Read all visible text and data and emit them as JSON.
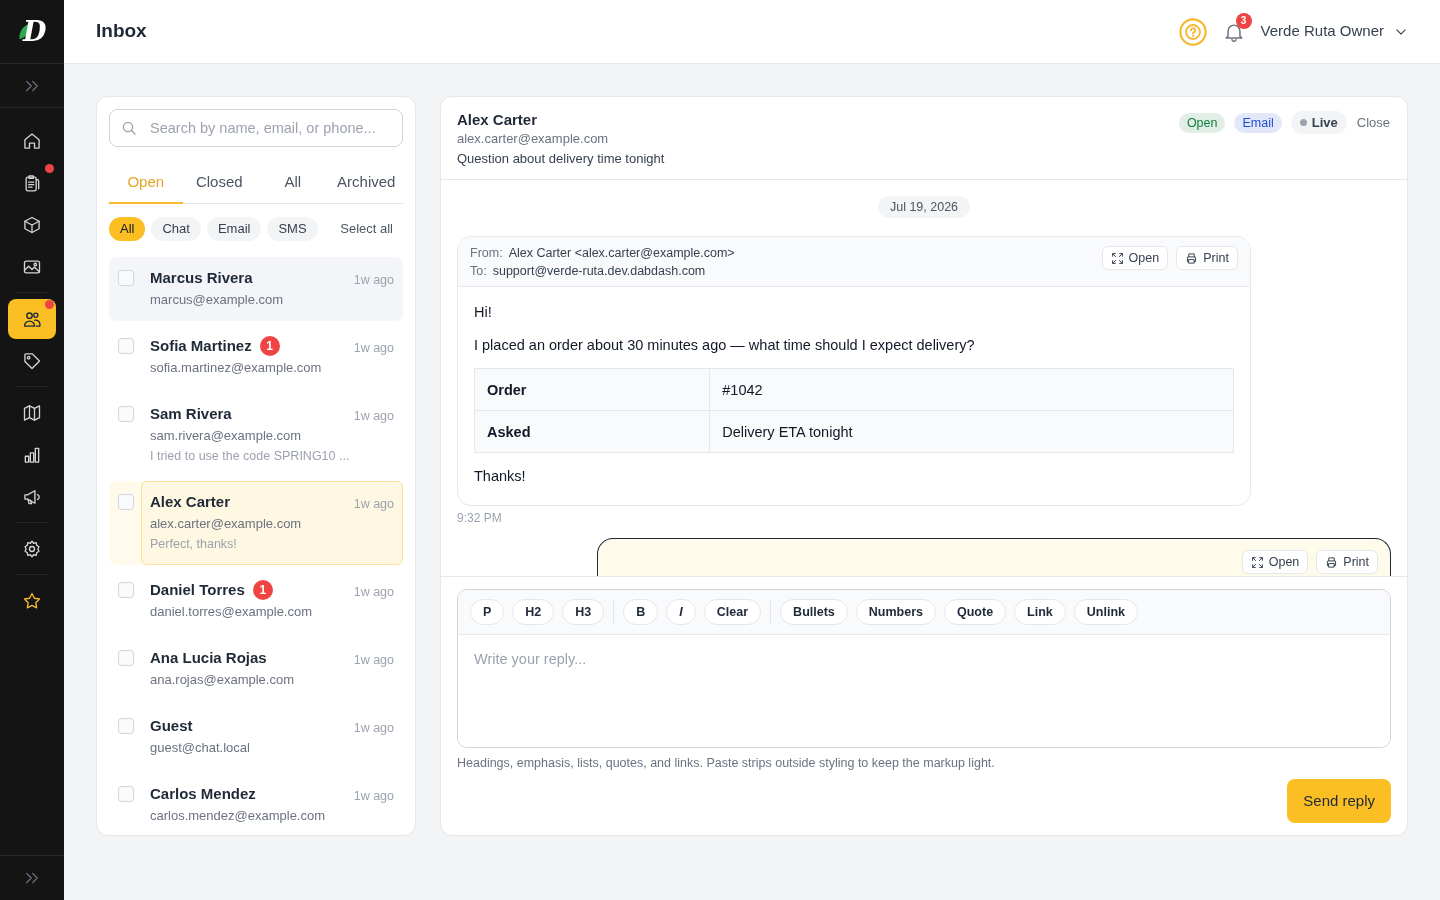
{
  "brand": {
    "logo_text": "D"
  },
  "sidebar": {
    "groups": [
      [
        {
          "selected": false,
          "alert": false
        },
        {
          "selected": false,
          "alert": true
        },
        {
          "selected": false,
          "alert": false
        },
        {
          "selected": false,
          "alert": false
        }
      ],
      [
        {
          "selected": true,
          "alert": true
        },
        {
          "selected": false,
          "alert": false
        }
      ],
      [
        {
          "selected": false,
          "alert": false
        },
        {
          "selected": false,
          "alert": false
        },
        {
          "selected": false,
          "alert": false
        }
      ],
      [
        {
          "selected": false,
          "alert": false
        }
      ],
      [
        {
          "selected": false,
          "alert": false
        }
      ]
    ]
  },
  "topbar": {
    "title": "Inbox",
    "notification_count": "3",
    "user": "Verde Ruta Owner"
  },
  "inbox": {
    "search": {
      "placeholder": "Search by name, email, or phone..."
    },
    "tabs": [
      {
        "label": "Open",
        "selected": true
      },
      {
        "label": "Closed",
        "selected": false
      },
      {
        "label": "All",
        "selected": false
      },
      {
        "label": "Archived",
        "selected": false
      }
    ],
    "filters": [
      {
        "label": "All",
        "selected": true
      },
      {
        "label": "Chat",
        "selected": false
      },
      {
        "label": "Email",
        "selected": false
      },
      {
        "label": "SMS",
        "selected": false
      }
    ],
    "select_all": "Select all",
    "conversations": [
      {
        "name": "Marcus Rivera",
        "email": "marcus@example.com",
        "time": "1w ago",
        "checked": false,
        "selected": false,
        "hovered": true
      },
      {
        "name": "Sofia Martinez",
        "unread": "1",
        "email": "sofia.martinez@example.com",
        "time": "1w ago",
        "checked": false,
        "selected": false,
        "hovered": false
      },
      {
        "name": "Sam Rivera",
        "email": "sam.rivera@example.com",
        "preview": "I tried to use the code SPRING10 ...",
        "time": "1w ago",
        "checked": false,
        "selected": false,
        "hovered": false
      },
      {
        "name": "Alex Carter",
        "email": "alex.carter@example.com",
        "preview": "Perfect, thanks!",
        "time": "1w ago",
        "checked": false,
        "selected": true,
        "hovered": false
      },
      {
        "name": "Daniel Torres",
        "unread": "1",
        "email": "daniel.torres@example.com",
        "time": "1w ago",
        "checked": false,
        "selected": false,
        "hovered": false
      },
      {
        "name": "Ana Lucia Rojas",
        "email": "ana.rojas@example.com",
        "time": "1w ago",
        "checked": false,
        "selected": false,
        "hovered": false
      },
      {
        "name": "Guest",
        "email": "guest@chat.local",
        "time": "1w ago",
        "checked": false,
        "selected": false,
        "hovered": false
      },
      {
        "name": "Carlos Mendez",
        "email": "carlos.mendez@example.com",
        "time": "1w ago",
        "checked": false,
        "selected": false,
        "hovered": false
      }
    ]
  },
  "conversation": {
    "name": "Alex Carter",
    "email": "alex.carter@example.com",
    "subject": "Question about delivery time tonight",
    "tags": [
      {
        "label": "Open",
        "color": "#15803d"
      },
      {
        "label": "Email",
        "color": "#1d4ed8"
      }
    ],
    "live": "Live",
    "close": "Close",
    "date": "Jul 19, 2026",
    "messages": [
      {
        "kind": "email",
        "from_label": "From:",
        "from": "Alex Carter <alex.carter@example.com>",
        "to_label": "To:",
        "to": "support@verde-ruta.dev.dabdash.com",
        "actions": [
          {
            "kind": "open",
            "label": "Open"
          },
          {
            "kind": "print",
            "label": "Print"
          }
        ],
        "body": [
          {
            "kind": "paragraph",
            "text": "Hi!"
          },
          {
            "kind": "paragraph",
            "text": "I placed an order about 30 minutes ago — what time should I expect delivery?"
          },
          {
            "kind": "table",
            "rows": [
              {
                "label": "Order",
                "value": "#1042"
              },
              {
                "label": "Asked",
                "value": "Delivery ETA tonight"
              }
            ]
          },
          {
            "kind": "paragraph",
            "text": "Thanks!"
          }
        ],
        "time": "9:32 PM"
      },
      {
        "kind": "outgoing",
        "actions": [
          {
            "kind": "open",
            "label": "Open"
          },
          {
            "kind": "print",
            "label": "Print"
          }
        ]
      }
    ]
  },
  "composer": {
    "toolbar": [
      [
        {
          "label": "P"
        },
        {
          "label": "H2"
        },
        {
          "label": "H3"
        }
      ],
      [
        {
          "label": "B"
        },
        {
          "label": "I",
          "italic": true
        },
        {
          "label": "Clear"
        }
      ],
      [
        {
          "label": "Bullets"
        },
        {
          "label": "Numbers"
        },
        {
          "label": "Quote"
        },
        {
          "label": "Link"
        },
        {
          "label": "Unlink"
        }
      ]
    ],
    "placeholder": "Write your reply...",
    "hint": "Headings, emphasis, lists, quotes, and links. Paste strips outside styling to keep the markup light.",
    "send": "Send reply"
  }
}
